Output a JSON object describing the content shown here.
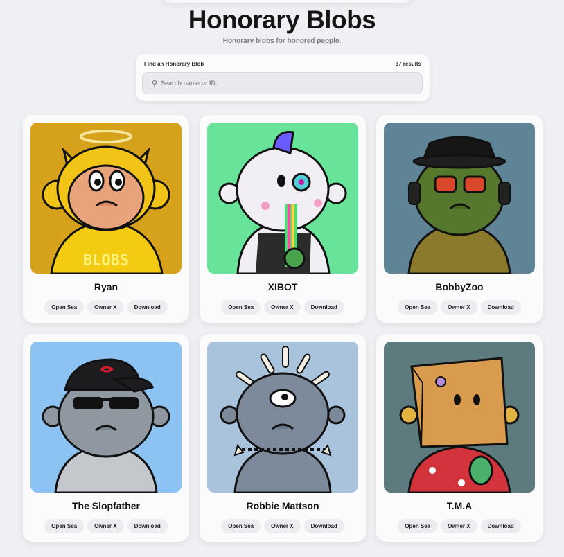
{
  "header": {
    "title": "Honorary Blobs",
    "subtitle": "Honorary blobs for honored people."
  },
  "search": {
    "label": "Find an Honorary Blob",
    "results": "37 results",
    "placeholder": "Search name or ID...",
    "icon": "search-icon"
  },
  "buttons": {
    "opensea": "Open Sea",
    "owner": "Owner X",
    "download": "Download"
  },
  "blobs": [
    {
      "name": "Ryan",
      "bg": "#d6a21c",
      "skin": "#e8a37a",
      "art_text": "BLOBS"
    },
    {
      "name": "XIBOT",
      "bg": "#67e39a",
      "skin": "#f1eef4"
    },
    {
      "name": "BobbyZoo",
      "bg": "#5e8495",
      "skin": "#56782c"
    },
    {
      "name": "The Slopfather",
      "bg": "#8cc3f2",
      "skin": "#8f98a0"
    },
    {
      "name": "Robbie Mattson",
      "bg": "#aac3dc",
      "skin": "#7d8a9c"
    },
    {
      "name": "T.M.A",
      "bg": "#5d7a7e",
      "skin": "#d99c4e"
    }
  ]
}
